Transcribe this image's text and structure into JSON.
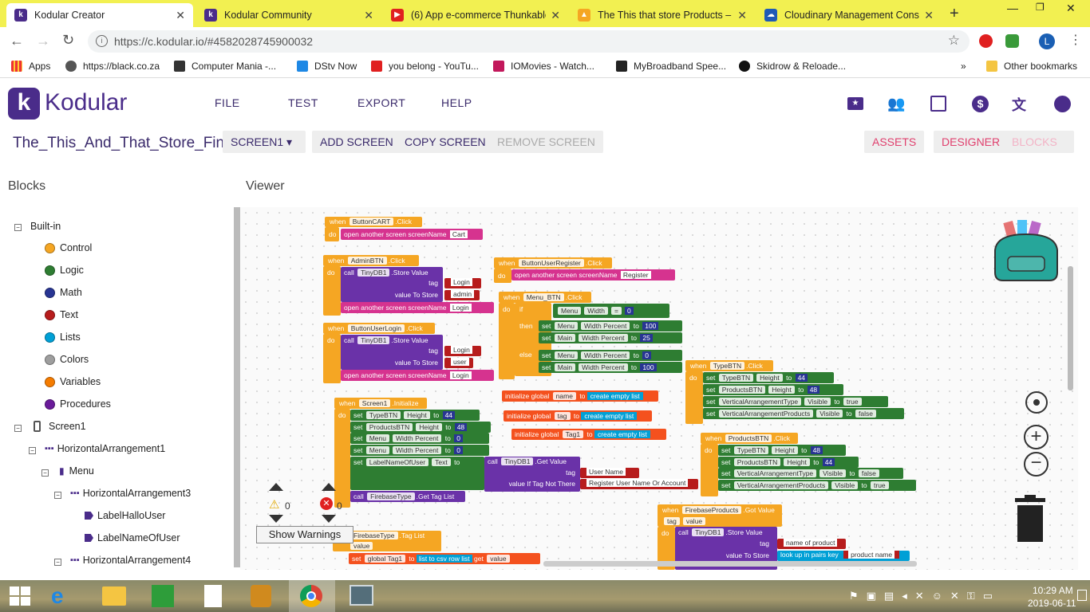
{
  "tabs": [
    {
      "title": "Kodular Creator",
      "active": true,
      "icon_color": "#4a2c8a"
    },
    {
      "title": "Kodular Community",
      "active": false,
      "icon_color": "#4a2c8a"
    },
    {
      "title": "(6) App e-commerce Thunkable",
      "active": false,
      "icon_color": "#e02020"
    },
    {
      "title": "The This that store Products – F",
      "active": false,
      "icon_color": "#f5a623"
    },
    {
      "title": "Cloudinary Management Conso",
      "active": false,
      "icon_color": "#1e5ab6"
    }
  ],
  "browser": {
    "url": "https://c.kodular.io/#4582028745900032",
    "profile_initial": "L"
  },
  "bookmarks": [
    {
      "label": "Apps"
    },
    {
      "label": "https://black.co.za"
    },
    {
      "label": "Computer Mania -..."
    },
    {
      "label": "DStv Now"
    },
    {
      "label": "you belong - YouTu..."
    },
    {
      "label": "IOMovies - Watch..."
    },
    {
      "label": "MyBroadband Spee..."
    },
    {
      "label": "Skidrow & Reloade..."
    }
  ],
  "other_bookmarks": "Other bookmarks",
  "app": {
    "logo_text": "Kodular",
    "menu": [
      "FILE",
      "TEST",
      "EXPORT",
      "HELP"
    ],
    "project_name": "The_This_And_That_Store_Final",
    "screen_selector": "SCREEN1 ▾",
    "add_screen": "ADD SCREEN",
    "copy_screen": "COPY SCREEN",
    "remove_screen": "REMOVE SCREEN",
    "assets": "ASSETS",
    "designer": "DESIGNER",
    "blocks": "BLOCKS",
    "accent": "#4a2c8a",
    "pink": "#e0406e"
  },
  "left_panel": {
    "title": "Blocks",
    "built_in": "Built-in",
    "categories": [
      {
        "label": "Control",
        "color": "#f5a623"
      },
      {
        "label": "Logic",
        "color": "#2e7d32"
      },
      {
        "label": "Math",
        "color": "#283593"
      },
      {
        "label": "Text",
        "color": "#b71c1c"
      },
      {
        "label": "Lists",
        "color": "#00a0d6"
      },
      {
        "label": "Colors",
        "color": "#9e9e9e"
      },
      {
        "label": "Variables",
        "color": "#f57c00"
      },
      {
        "label": "Procedures",
        "color": "#6a1b9a"
      }
    ],
    "components": [
      {
        "label": "Screen1"
      },
      {
        "label": "HorizontalArrangement1"
      },
      {
        "label": "Menu"
      },
      {
        "label": "HorizontalArrangement3"
      },
      {
        "label": "LabelHalloUser"
      },
      {
        "label": "LabelNameOfUser"
      },
      {
        "label": "HorizontalArrangement4"
      }
    ]
  },
  "viewer": {
    "title": "Viewer",
    "warnings_count": "0",
    "errors_count": "0",
    "show_warnings": "Show Warnings"
  },
  "blocks": {
    "b1": {
      "when": "when",
      "event": "ButtonCART",
      "click": ".Click",
      "do": "do",
      "action": "open another screen  screenName",
      "value": "Cart"
    },
    "b2": {
      "when": "when",
      "event": "AdminBTN",
      "click": ".Click",
      "do": "do",
      "call": "call",
      "db": "TinyDB1",
      "store": ".Store Value",
      "tag": "tag",
      "tag_v": "Login",
      "vts": "value To Store",
      "vts_v": "admin",
      "open": "open another screen  screenName",
      "open_v": "Login"
    },
    "b3": {
      "when": "when",
      "event": "ButtonUserLogin",
      "click": ".Click",
      "do": "do",
      "call": "call",
      "db": "TinyDB1",
      "store": ".Store Value",
      "tag": "tag",
      "tag_v": "Login",
      "vts": "value To Store",
      "vts_v": "user",
      "open": "open another screen  screenName",
      "open_v": "Login"
    },
    "b4": {
      "when": "when",
      "event": "ButtonUserRegister",
      "click": ".Click",
      "do": "do",
      "action": "open another screen  screenName",
      "value": "Register"
    },
    "b5": {
      "when": "when",
      "event": "Menu_BTN",
      "click": ".Click",
      "do": "do",
      "if": "if",
      "cmp_comp": "Menu",
      "cmp_prop": "Width",
      "cmp_op": "=",
      "cmp_v": "0",
      "then": "then",
      "set": "set",
      "to": "to",
      "t1_comp": "Menu",
      "t1_prop": "Width Percent",
      "t1_v": "100",
      "t2_comp": "Main",
      "t2_prop": "Width Percent",
      "t2_v": "25",
      "else": "else",
      "e1_comp": "Menu",
      "e1_prop": "Width Percent",
      "e1_v": "0",
      "e2_comp": "Main",
      "e2_prop": "Width Percent",
      "e2_v": "100"
    },
    "g1": {
      "init": "initialize global",
      "name": "name",
      "to": "to",
      "list": "create empty list"
    },
    "g2": {
      "init": "initialize global",
      "name": "tag",
      "to": "to",
      "list": "create empty list"
    },
    "g3": {
      "init": "initialize global",
      "name": "Tag1",
      "to": "to",
      "list": "create empty list"
    },
    "b6": {
      "when": "when",
      "event": "TypeBTN",
      "click": ".Click",
      "do": "do",
      "set": "set",
      "to": "to",
      "r1_comp": "TypeBTN",
      "r1_prop": "Height",
      "r1_v": "44",
      "r2_comp": "ProductsBTN",
      "r2_prop": "Height",
      "r2_v": "48",
      "r3_comp": "VerticalArrangementType",
      "r3_prop": "Visible",
      "r3_v": "true",
      "r4_comp": "VerticalArrangementProducts",
      "r4_prop": "Visible",
      "r4_v": "false"
    },
    "b7": {
      "when": "when",
      "event": "Screen1",
      "init": ".Initialize",
      "do": "do",
      "set": "set",
      "to": "to",
      "r1_comp": "TypeBTN",
      "r1_prop": "Height",
      "r1_v": "44",
      "r2_comp": "ProductsBTN",
      "r2_prop": "Height",
      "r2_v": "48",
      "r3_comp": "Menu",
      "r3_prop": "Width Percent",
      "r3_v": "0",
      "r4_comp": "Menu",
      "r4_prop": "Width Percent",
      "r4_v": "0",
      "r5_comp": "LabelNameOfUser",
      "r5_prop": "Text",
      "call": "call",
      "db": "TinyDB1",
      "get": ".Get Value",
      "tag": "tag",
      "tag_v": "User Name",
      "vitnt": "value If Tag Not There",
      "vitnt_v": "Register User Name Or Account",
      "call2_comp": "FirebaseType",
      "call2_method": ".Get Tag List"
    },
    "b8": {
      "when": "when",
      "event": "ProductsBTN",
      "click": ".Click",
      "do": "do",
      "set": "set",
      "to": "to",
      "r1_comp": "TypeBTN",
      "r1_prop": "Height",
      "r1_v": "48",
      "r2_comp": "ProductsBTN",
      "r2_prop": "Height",
      "r2_v": "44",
      "r3_comp": "VerticalArrangementType",
      "r3_prop": "Visible",
      "r3_v": "false",
      "r4_comp": "VerticalArrangementProducts",
      "r4_prop": "Visible",
      "r4_v": "true"
    },
    "b9": {
      "when": "when",
      "event": "FirebaseProducts",
      "got": ".Got Value",
      "tag": "tag",
      "value": "value",
      "do": "do",
      "call": "call",
      "db": "TinyDB1",
      "store": ".Store Value",
      "tag2": "tag",
      "tag2_v": "name of product",
      "vts": "value To Store",
      "lookup": "look up in pairs  key",
      "lookup_v": "product name"
    },
    "b10": {
      "when": "when",
      "event": "FirebaseType",
      "tl": ".Tag List",
      "value": "value",
      "set": "set",
      "gv": "global Tag1",
      "to": "to",
      "ltcr": "list to csv row  list",
      "get": "get",
      "getv": "value"
    }
  },
  "taskbar": {
    "time": "10:29 AM",
    "date": "2019-06-11"
  }
}
